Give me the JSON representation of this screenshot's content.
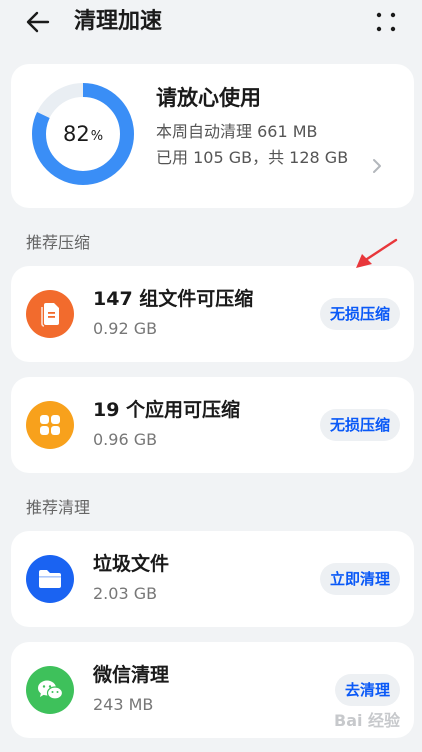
{
  "header": {
    "title": "清理加速"
  },
  "status": {
    "percent": "82",
    "percent_unit": "%",
    "ring_fraction": 0.82,
    "title": "请放心使用",
    "weekly_cleaned": "本周自动清理 661 MB",
    "usage": "已用 105 GB，共 128 GB"
  },
  "sections": {
    "compress": "推荐压缩",
    "clean": "推荐清理"
  },
  "items": [
    {
      "title": "147 组文件可压缩",
      "size": "0.92 GB",
      "action": "无损压缩",
      "icon": "document-icon",
      "color": "#f26b2d"
    },
    {
      "title": "19 个应用可压缩",
      "size": "0.96 GB",
      "action": "无损压缩",
      "icon": "apps-grid-icon",
      "color": "#f8a11c"
    },
    {
      "title": "垃圾文件",
      "size": "2.03 GB",
      "action": "立即清理",
      "icon": "folder-icon",
      "color": "#1a63f2"
    },
    {
      "title": "微信清理",
      "size": "243 MB",
      "action": "去清理",
      "icon": "wechat-icon",
      "color": "#3ec15b"
    }
  ],
  "colors": {
    "accent": "#0a59f7",
    "ring": "#3a8ef6",
    "ring_track": "#e9eef3",
    "annotation_arrow": "#e8373b"
  },
  "watermark": {
    "text": "Bai 经验"
  }
}
